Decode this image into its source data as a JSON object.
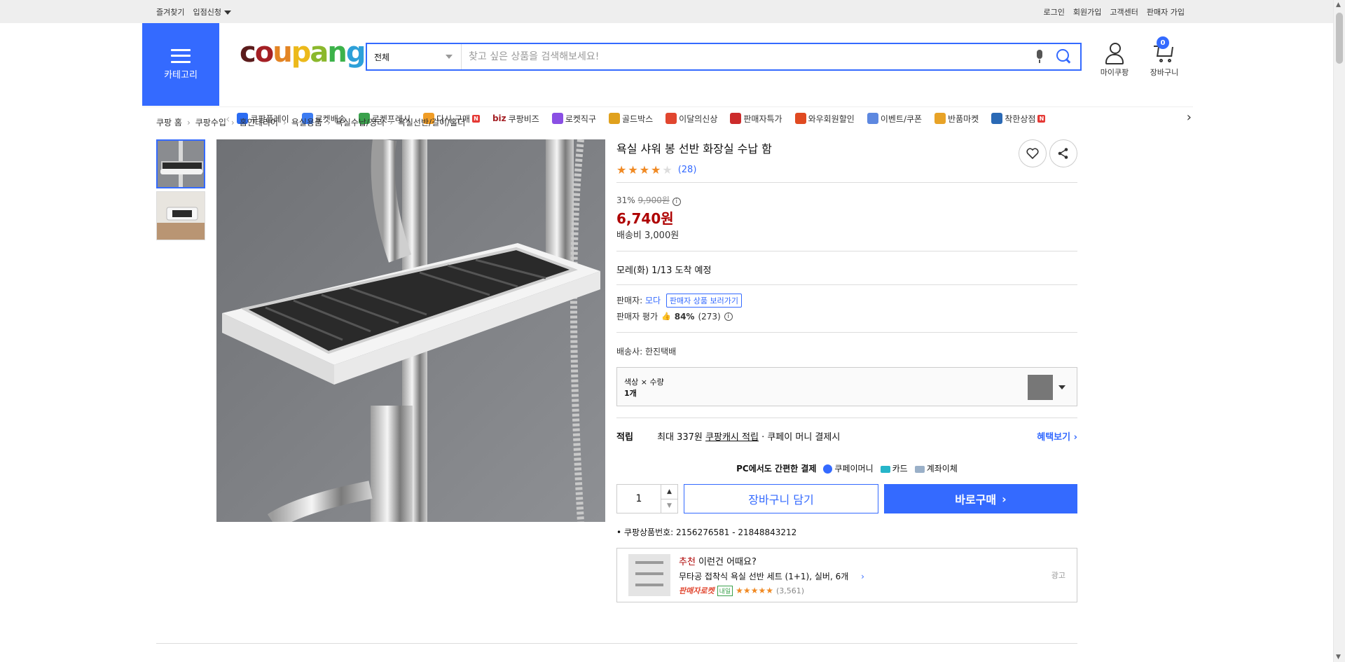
{
  "topbar": {
    "left": [
      "즐겨찾기",
      "입점신청"
    ],
    "right": [
      "로그인",
      "회원가입",
      "고객센터",
      "판매자 가입"
    ]
  },
  "header": {
    "category_label": "카테고리",
    "logo": "coupang",
    "search_category": "전체",
    "search_placeholder": "찾고 싶은 상품을 검색해보세요!",
    "mypage_label": "마이쿠팡",
    "cart_label": "장바구니",
    "cart_count": "0"
  },
  "nav": {
    "items": [
      {
        "label": "쿠팡플레이",
        "icon": "play-icon",
        "color": "#2b6cf2"
      },
      {
        "label": "로켓배송",
        "icon": "rocket-icon",
        "color": "#3d7cf2"
      },
      {
        "label": "로켓프레시",
        "icon": "fresh-rocket-icon",
        "color": "#3aa14c"
      },
      {
        "label": "다시 구매",
        "icon": "rebuy-icon",
        "color": "#f09d26",
        "badge": "N"
      },
      {
        "label": "쿠팡비즈",
        "prefix": "biz",
        "icon": "biz-icon",
        "color": "#333"
      },
      {
        "label": "로켓직구",
        "icon": "direct-rocket-icon",
        "color": "#8a4fe4"
      },
      {
        "label": "골드박스",
        "icon": "goldbox-icon",
        "color": "#e0a11d"
      },
      {
        "label": "이달의신상",
        "icon": "new-product-icon",
        "color": "#e1462f"
      },
      {
        "label": "판매자특가",
        "icon": "seller-deal-icon",
        "color": "#cc2b2b"
      },
      {
        "label": "와우회원할인",
        "icon": "wow-icon",
        "color": "#e04a21"
      },
      {
        "label": "이벤트/쿠폰",
        "icon": "coupon-icon",
        "color": "#5d88e0"
      },
      {
        "label": "반품마켓",
        "icon": "return-market-icon",
        "color": "#e8a327"
      },
      {
        "label": "착한상점",
        "icon": "good-shop-icon",
        "color": "#2a69b5",
        "badge": "N"
      }
    ]
  },
  "breadcrumb": [
    "쿠팡 홈",
    "쿠팡수입",
    "홈인테리어",
    "욕실용품",
    "욕실수납/정리",
    "욕실선반/걸이/홀더"
  ],
  "product": {
    "title": "욕실 샤워 봉 선반 화장실 수납 함",
    "rating_stars": 4,
    "review_count": "(28)",
    "discount_rate": "31%",
    "original_price": "9,900원",
    "price": "6,740원",
    "shipping_fee": "배송비 3,000원",
    "arrival": "모레(화) 1/13 도착 예정",
    "seller_label": "판매자:",
    "seller_name": "모다",
    "seller_link": "판매자 상품 보러가기",
    "seller_rating_label": "판매자 평가",
    "seller_rating_value": "84%",
    "seller_rating_count": "(273)",
    "courier_label": "배송사:",
    "courier": "한진택배",
    "option_label": "색상 × 수량",
    "option_value": "1개",
    "reward_title": "적립",
    "reward_text_1": "최대 337원",
    "reward_text_2": "쿠팡캐시 적립",
    "reward_text_3": "· 쿠페이 머니 결제시",
    "reward_link": "혜택보기",
    "pay_title": "PC에서도 간편한 결제",
    "pay_methods": [
      "쿠페이머니",
      "카드",
      "계좌이체"
    ],
    "quantity": "1",
    "add_cart": "장바구니 담기",
    "buy_now": "바로구매",
    "product_id_label": "쿠팡상품번호:",
    "product_id": "2156276581 - 21848843212"
  },
  "recommend": {
    "head_red": "추천",
    "head_rest": " 이런건 어때요?",
    "item_title": "무타공 접착식 욕실 선반 세트 (1+1), 실버, 6개",
    "seller_rocket": "판매자로켓",
    "delivery_tag": "내일",
    "stars": 4.5,
    "reviews": "(3,561)",
    "ad_label": "광고"
  },
  "colors": {
    "brand_blue": "#346aff",
    "price_red": "#ae0000",
    "star_orange": "#f08a24"
  }
}
